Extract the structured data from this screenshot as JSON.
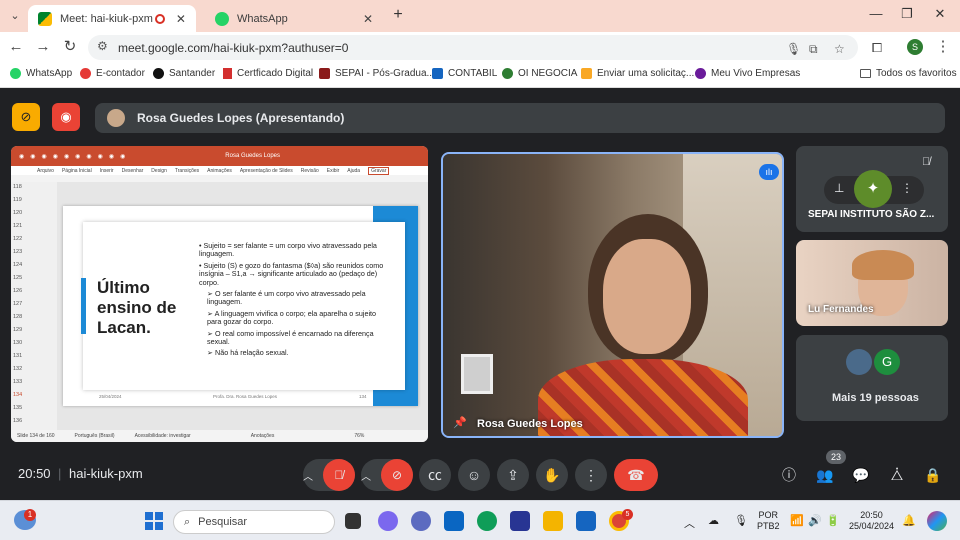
{
  "tabs": [
    {
      "title": "Meet: hai-kiuk-pxm",
      "recording_icon": "record-icon",
      "close": "✕"
    },
    {
      "title": "WhatsApp",
      "close": "✕"
    }
  ],
  "new_tab": "+",
  "window_controls": {
    "minimize": "—",
    "maximize": "❐",
    "close": "✕"
  },
  "url": "meet.google.com/hai-kiuk-pxm?authuser=0",
  "profile_initial": "S",
  "bookmarks": [
    "WhatsApp",
    "E-contador",
    "Santander",
    "Certficado Digital",
    "SEPAI - Pós-Gradua...",
    "CONTABIL",
    "OI NEGOCIA",
    "Enviar uma solicitaç...",
    "Meu Vivo Empresas"
  ],
  "all_favorites": "Todos os favoritos",
  "presenter_banner": "Rosa Guedes Lopes (Apresentando)",
  "ppt": {
    "doc_title": "Rosa Guedes Lopes",
    "menu": [
      "Arquivo",
      "Página Inicial",
      "Inserir",
      "Desenhar",
      "Design",
      "Transições",
      "Animações",
      "Apresentação de Slides",
      "Revisão",
      "Exibir",
      "Ajuda"
    ],
    "record_button": "Gravar",
    "slide_numbers": [
      "118",
      "119",
      "120",
      "121",
      "122",
      "123",
      "124",
      "125",
      "126",
      "127",
      "128",
      "129",
      "130",
      "131",
      "132",
      "133",
      "134",
      "135",
      "136"
    ],
    "slide_title": "Último ensino de Lacan.",
    "bullets": [
      "Sujeito = ser falante = um corpo vivo atravessado pela linguagem.",
      "Sujeito (S) e gozo do fantasma ($◊a) são reunidos como insígnia – S1,a → significante articulado ao (pedaço de) corpo."
    ],
    "sub_bullets": [
      "O ser falante é um corpo vivo atravessado pela linguagem.",
      "A linguagem vivifica o corpo; ela aparelha o sujeito para gozar do corpo.",
      "O real como impossível é encarnado na diferença sexual.",
      "Não há relação sexual."
    ],
    "footer_date": "25/04/2024",
    "footer_author": "Profa. Dra. Rosa Guedes Lopes",
    "footer_page": "134",
    "status": [
      "Slide 134 de 160",
      "Português (Brasil)",
      "Acessibilidade: investigar",
      "Anotações",
      "76%"
    ]
  },
  "speaker_name": "Rosa Guedes Lopes",
  "participants": [
    {
      "name": "SEPAI INSTITUTO SÃO Z..."
    },
    {
      "name": "Lu Fernandes"
    }
  ],
  "more_people": {
    "label": "Mais 19 pessoas",
    "avatar_initial": "G"
  },
  "meeting": {
    "time": "20:50",
    "code": "hai-kiuk-pxm",
    "participant_count": "23"
  },
  "taskbar": {
    "search_placeholder": "Pesquisar",
    "weather_badge": "1",
    "language": "POR",
    "layout": "PTB2",
    "clock_time": "20:50",
    "clock_date": "25/04/2024",
    "chrome_badge": "5"
  }
}
